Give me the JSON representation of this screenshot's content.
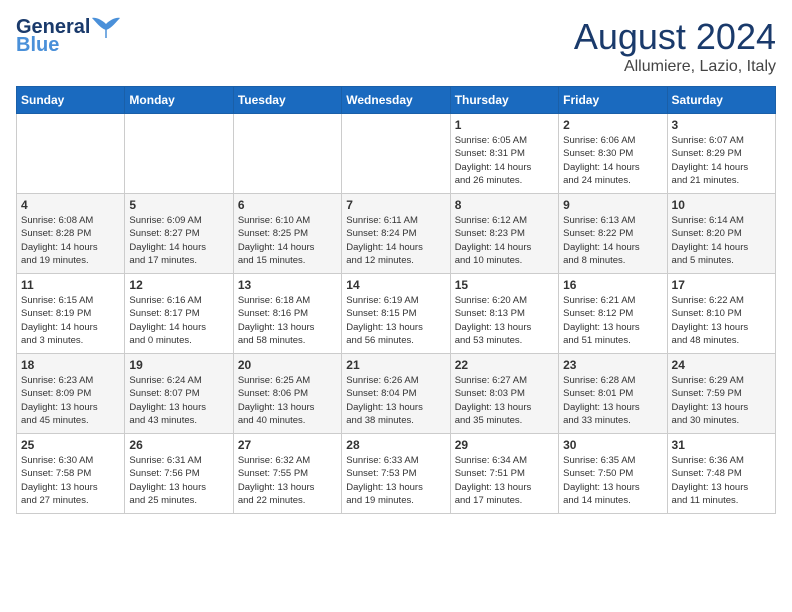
{
  "header": {
    "logo_line1": "General",
    "logo_line2": "Blue",
    "month_title": "August 2024",
    "location": "Allumiere, Lazio, Italy"
  },
  "weekdays": [
    "Sunday",
    "Monday",
    "Tuesday",
    "Wednesday",
    "Thursday",
    "Friday",
    "Saturday"
  ],
  "weeks": [
    [
      {
        "day": "",
        "info": ""
      },
      {
        "day": "",
        "info": ""
      },
      {
        "day": "",
        "info": ""
      },
      {
        "day": "",
        "info": ""
      },
      {
        "day": "1",
        "info": "Sunrise: 6:05 AM\nSunset: 8:31 PM\nDaylight: 14 hours\nand 26 minutes."
      },
      {
        "day": "2",
        "info": "Sunrise: 6:06 AM\nSunset: 8:30 PM\nDaylight: 14 hours\nand 24 minutes."
      },
      {
        "day": "3",
        "info": "Sunrise: 6:07 AM\nSunset: 8:29 PM\nDaylight: 14 hours\nand 21 minutes."
      }
    ],
    [
      {
        "day": "4",
        "info": "Sunrise: 6:08 AM\nSunset: 8:28 PM\nDaylight: 14 hours\nand 19 minutes."
      },
      {
        "day": "5",
        "info": "Sunrise: 6:09 AM\nSunset: 8:27 PM\nDaylight: 14 hours\nand 17 minutes."
      },
      {
        "day": "6",
        "info": "Sunrise: 6:10 AM\nSunset: 8:25 PM\nDaylight: 14 hours\nand 15 minutes."
      },
      {
        "day": "7",
        "info": "Sunrise: 6:11 AM\nSunset: 8:24 PM\nDaylight: 14 hours\nand 12 minutes."
      },
      {
        "day": "8",
        "info": "Sunrise: 6:12 AM\nSunset: 8:23 PM\nDaylight: 14 hours\nand 10 minutes."
      },
      {
        "day": "9",
        "info": "Sunrise: 6:13 AM\nSunset: 8:22 PM\nDaylight: 14 hours\nand 8 minutes."
      },
      {
        "day": "10",
        "info": "Sunrise: 6:14 AM\nSunset: 8:20 PM\nDaylight: 14 hours\nand 5 minutes."
      }
    ],
    [
      {
        "day": "11",
        "info": "Sunrise: 6:15 AM\nSunset: 8:19 PM\nDaylight: 14 hours\nand 3 minutes."
      },
      {
        "day": "12",
        "info": "Sunrise: 6:16 AM\nSunset: 8:17 PM\nDaylight: 14 hours\nand 0 minutes."
      },
      {
        "day": "13",
        "info": "Sunrise: 6:18 AM\nSunset: 8:16 PM\nDaylight: 13 hours\nand 58 minutes."
      },
      {
        "day": "14",
        "info": "Sunrise: 6:19 AM\nSunset: 8:15 PM\nDaylight: 13 hours\nand 56 minutes."
      },
      {
        "day": "15",
        "info": "Sunrise: 6:20 AM\nSunset: 8:13 PM\nDaylight: 13 hours\nand 53 minutes."
      },
      {
        "day": "16",
        "info": "Sunrise: 6:21 AM\nSunset: 8:12 PM\nDaylight: 13 hours\nand 51 minutes."
      },
      {
        "day": "17",
        "info": "Sunrise: 6:22 AM\nSunset: 8:10 PM\nDaylight: 13 hours\nand 48 minutes."
      }
    ],
    [
      {
        "day": "18",
        "info": "Sunrise: 6:23 AM\nSunset: 8:09 PM\nDaylight: 13 hours\nand 45 minutes."
      },
      {
        "day": "19",
        "info": "Sunrise: 6:24 AM\nSunset: 8:07 PM\nDaylight: 13 hours\nand 43 minutes."
      },
      {
        "day": "20",
        "info": "Sunrise: 6:25 AM\nSunset: 8:06 PM\nDaylight: 13 hours\nand 40 minutes."
      },
      {
        "day": "21",
        "info": "Sunrise: 6:26 AM\nSunset: 8:04 PM\nDaylight: 13 hours\nand 38 minutes."
      },
      {
        "day": "22",
        "info": "Sunrise: 6:27 AM\nSunset: 8:03 PM\nDaylight: 13 hours\nand 35 minutes."
      },
      {
        "day": "23",
        "info": "Sunrise: 6:28 AM\nSunset: 8:01 PM\nDaylight: 13 hours\nand 33 minutes."
      },
      {
        "day": "24",
        "info": "Sunrise: 6:29 AM\nSunset: 7:59 PM\nDaylight: 13 hours\nand 30 minutes."
      }
    ],
    [
      {
        "day": "25",
        "info": "Sunrise: 6:30 AM\nSunset: 7:58 PM\nDaylight: 13 hours\nand 27 minutes."
      },
      {
        "day": "26",
        "info": "Sunrise: 6:31 AM\nSunset: 7:56 PM\nDaylight: 13 hours\nand 25 minutes."
      },
      {
        "day": "27",
        "info": "Sunrise: 6:32 AM\nSunset: 7:55 PM\nDaylight: 13 hours\nand 22 minutes."
      },
      {
        "day": "28",
        "info": "Sunrise: 6:33 AM\nSunset: 7:53 PM\nDaylight: 13 hours\nand 19 minutes."
      },
      {
        "day": "29",
        "info": "Sunrise: 6:34 AM\nSunset: 7:51 PM\nDaylight: 13 hours\nand 17 minutes."
      },
      {
        "day": "30",
        "info": "Sunrise: 6:35 AM\nSunset: 7:50 PM\nDaylight: 13 hours\nand 14 minutes."
      },
      {
        "day": "31",
        "info": "Sunrise: 6:36 AM\nSunset: 7:48 PM\nDaylight: 13 hours\nand 11 minutes."
      }
    ]
  ]
}
